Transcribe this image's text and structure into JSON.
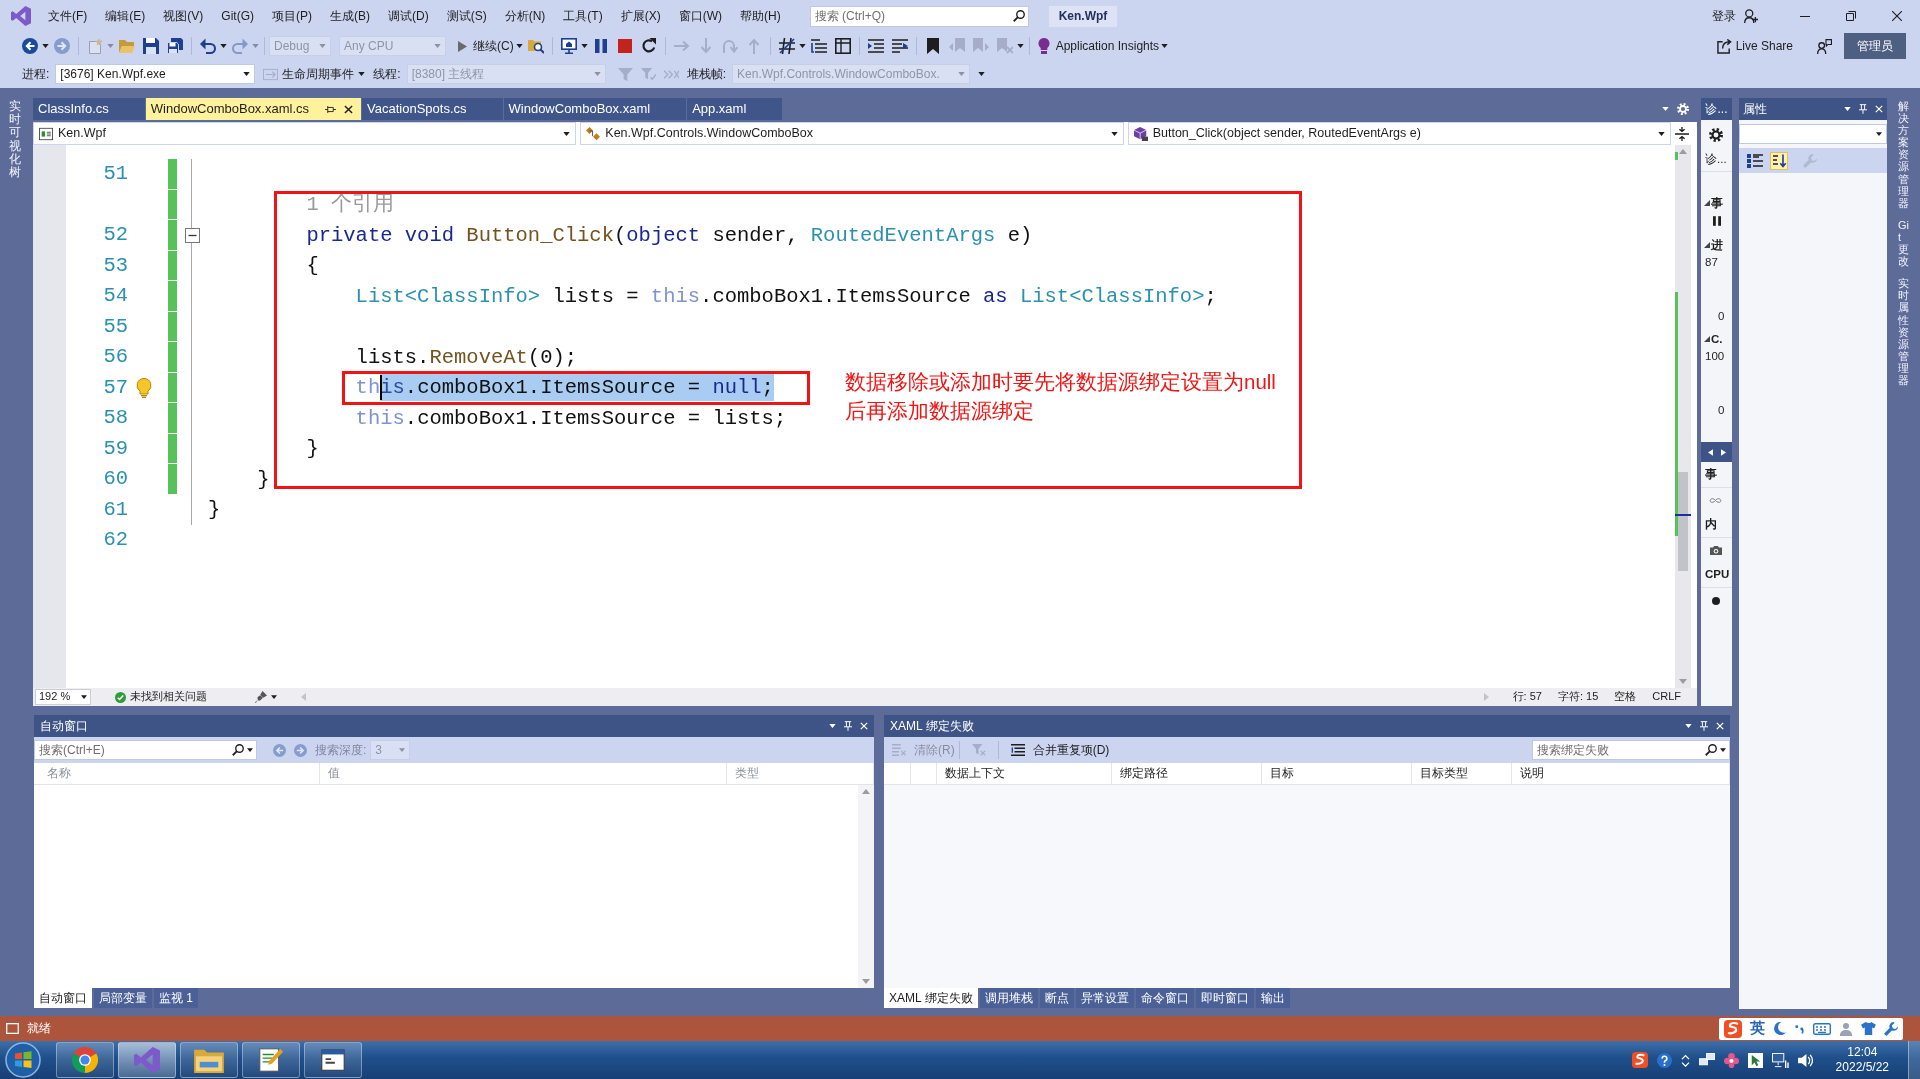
{
  "title_bar": {
    "menu": [
      "文件(F)",
      "编辑(E)",
      "视图(V)",
      "Git(G)",
      "项目(P)",
      "生成(B)",
      "调试(D)",
      "测试(S)",
      "分析(N)",
      "工具(T)",
      "扩展(X)",
      "窗口(W)",
      "帮助(H)"
    ],
    "search_placeholder": "搜索 (Ctrl+Q)",
    "solution": "Ken.Wpf",
    "sign_in": "登录"
  },
  "toolbar": {
    "groups": [
      [
        {
          "kind": "back",
          "disabled": false
        },
        {
          "kind": "caret",
          "disabled": false
        },
        {
          "kind": "forward",
          "disabled": true
        }
      ],
      [
        {
          "kind": "new",
          "disabled": true
        },
        {
          "kind": "caret",
          "disabled": true
        },
        {
          "kind": "open",
          "disabled": false
        },
        {
          "kind": "save",
          "disabled": false
        },
        {
          "kind": "saveall",
          "disabled": false
        }
      ],
      [
        {
          "kind": "undo",
          "disabled": false
        },
        {
          "kind": "caret",
          "disabled": false
        },
        {
          "kind": "redo",
          "disabled": true
        },
        {
          "kind": "caret",
          "disabled": true
        }
      ],
      [
        {
          "kind": "combo",
          "text": "Debug",
          "disabled": true
        },
        {
          "kind": "combo",
          "text": "Any CPU",
          "disabled": true
        },
        {
          "kind": "run",
          "text": "继续(C)",
          "disabled": false
        },
        {
          "kind": "caret",
          "disabled": false
        },
        {
          "kind": "find",
          "disabled": false
        }
      ],
      [
        {
          "kind": "monitor",
          "disabled": false
        },
        {
          "kind": "caret",
          "disabled": false
        },
        {
          "kind": "pause",
          "disabled": false
        },
        {
          "kind": "stop",
          "disabled": false
        },
        {
          "kind": "restart",
          "disabled": false
        }
      ],
      [
        {
          "kind": "arrow_right",
          "disabled": true
        },
        {
          "kind": "arrow_down",
          "disabled": true
        },
        {
          "kind": "arrow_curve",
          "disabled": true
        },
        {
          "kind": "arrow_up",
          "disabled": true
        }
      ],
      [
        {
          "kind": "hash",
          "disabled": false
        },
        {
          "kind": "caret",
          "disabled": false
        },
        {
          "kind": "list",
          "disabled": false
        },
        {
          "kind": "columns",
          "disabled": false
        }
      ],
      [
        {
          "kind": "indent",
          "disabled": false
        },
        {
          "kind": "comment",
          "disabled": false
        }
      ],
      [
        {
          "kind": "bookmark",
          "disabled": false
        },
        {
          "kind": "bookmark_prev",
          "disabled": true
        },
        {
          "kind": "bookmark_next",
          "disabled": true
        },
        {
          "kind": "bookmark_clear",
          "disabled": true
        },
        {
          "kind": "caret",
          "disabled": false
        }
      ],
      [
        {
          "kind": "insights",
          "text": "Application Insights",
          "disabled": false
        },
        {
          "kind": "caret",
          "disabled": false
        }
      ]
    ],
    "live_share": "Live Share",
    "admin": "管理员"
  },
  "debug_bar": {
    "process_label": "进程:",
    "process": "[3676] Ken.Wpf.exe",
    "lifecycle": "生命周期事件",
    "thread_label": "线程:",
    "thread": {
      "text": "[8380] 主线程",
      "disabled": true
    },
    "stack_label": "堆栈帧:",
    "stack_frame": {
      "text": "Ken.Wpf.Controls.WindowComboBox.",
      "disabled": true
    }
  },
  "left_strip": {
    "tabs": [
      "实时可视化树"
    ]
  },
  "editor": {
    "tabs": [
      {
        "label": "ClassInfo.cs",
        "selected": false
      },
      {
        "label": "WindowComboBox.xaml.cs",
        "selected": true
      },
      {
        "label": "VacationSpots.cs",
        "selected": false
      },
      {
        "label": "WindowComboBox.xaml",
        "selected": false
      },
      {
        "label": "App.xaml",
        "selected": false
      }
    ],
    "nav": {
      "project": "Ken.Wpf",
      "type": "Ken.Wpf.Controls.WindowComboBox",
      "member": "Button_Click(object sender, RoutedEventArgs e)"
    },
    "lines": [
      {
        "kind": "code",
        "number": "51",
        "changed": true
      },
      {
        "kind": "codelens",
        "text": "        1 个引用",
        "changed": true
      },
      {
        "kind": "code",
        "number": "52",
        "changed": true,
        "expanded": true,
        "segments": [
          {
            "selected": false,
            "tokens": [
              {
                "text": "        private void ",
                "kind": "keyword"
              },
              {
                "text": "Button_Click",
                "kind": "method"
              },
              {
                "text": "(",
                "kind": "plain"
              },
              {
                "text": "object",
                "kind": "keyword"
              },
              {
                "text": " sender, ",
                "kind": "plain"
              },
              {
                "text": "RoutedEventArgs",
                "kind": "type"
              },
              {
                "text": " e)",
                "kind": "plain"
              }
            ]
          }
        ]
      },
      {
        "kind": "code",
        "number": "53",
        "changed": true,
        "segments": [
          {
            "selected": false,
            "tokens": [
              {
                "text": "        {",
                "kind": "plain"
              }
            ]
          }
        ]
      },
      {
        "kind": "code",
        "number": "54",
        "changed": true,
        "segments": [
          {
            "selected": false,
            "tokens": [
              {
                "text": "            List<ClassInfo>",
                "kind": "type"
              },
              {
                "text": " lists = ",
                "kind": "plain"
              },
              {
                "text": "this",
                "kind": "this"
              },
              {
                "text": ".comboBox1.ItemsSource ",
                "kind": "plain"
              },
              {
                "text": "as ",
                "kind": "keyword"
              },
              {
                "text": "List<ClassInfo>",
                "kind": "type"
              },
              {
                "text": ";",
                "kind": "plain"
              }
            ]
          }
        ]
      },
      {
        "kind": "code",
        "number": "55",
        "changed": true
      },
      {
        "kind": "code",
        "number": "56",
        "changed": true,
        "segments": [
          {
            "selected": false,
            "tokens": [
              {
                "text": "            lists.",
                "kind": "plain"
              },
              {
                "text": "RemoveAt",
                "kind": "method"
              },
              {
                "text": "(0);",
                "kind": "plain"
              }
            ]
          }
        ]
      },
      {
        "kind": "code",
        "number": "57",
        "changed": true,
        "lightbulb": true,
        "segments": [
          {
            "selected": false,
            "tokens": [
              {
                "text": "            th",
                "kind": "this"
              }
            ]
          },
          {
            "selected": true,
            "caret": true,
            "tokens": [
              {
                "text": "is",
                "kind": "this"
              },
              {
                "text": ".comboBox1.ItemsSource = ",
                "kind": "plain"
              },
              {
                "text": "null",
                "kind": "keyword"
              },
              {
                "text": ";",
                "kind": "plain"
              }
            ]
          }
        ]
      },
      {
        "kind": "code",
        "number": "58",
        "changed": true,
        "segments": [
          {
            "selected": false,
            "tokens": [
              {
                "text": "            this",
                "kind": "this"
              },
              {
                "text": ".comboBox1.ItemsSource = lists;",
                "kind": "plain"
              }
            ]
          }
        ]
      },
      {
        "kind": "code",
        "number": "59",
        "changed": true,
        "segments": [
          {
            "selected": false,
            "tokens": [
              {
                "text": "        }",
                "kind": "plain"
              }
            ]
          }
        ]
      },
      {
        "kind": "code",
        "number": "60",
        "changed": true,
        "segments": [
          {
            "selected": false,
            "tokens": [
              {
                "text": "    }",
                "kind": "plain"
              }
            ]
          }
        ]
      },
      {
        "kind": "code",
        "number": "61",
        "changed": false,
        "segments": [
          {
            "selected": false,
            "tokens": [
              {
                "text": "}",
                "kind": "plain"
              }
            ]
          }
        ]
      },
      {
        "kind": "code",
        "number": "62",
        "changed": false
      }
    ],
    "annotation": {
      "note_lines": [
        "数据移除或添加时要先将数据源绑定设置为null",
        "后再添加数据源绑定"
      ]
    },
    "status": {
      "zoom": "192 %",
      "issues": "未找到相关问题",
      "line": "行: 57",
      "column": "字符: 15",
      "indent": "空格",
      "eol": "CRLF"
    }
  },
  "diagnostics": {
    "title": "诊...",
    "items": [
      {
        "kind": "gear"
      },
      {
        "kind": "label",
        "text": "诊..."
      },
      {
        "kind": "section",
        "text": "事"
      },
      {
        "kind": "pause"
      },
      {
        "kind": "section",
        "text": "进"
      },
      {
        "kind": "axis_max",
        "text": "87"
      },
      {
        "kind": "axis_min",
        "text": "0"
      },
      {
        "kind": "section",
        "text": "C."
      },
      {
        "kind": "axis_max",
        "text": "100"
      },
      {
        "kind": "axis_min",
        "text": "0"
      },
      {
        "kind": "nav"
      },
      {
        "kind": "heading",
        "text": "事"
      },
      {
        "kind": "infinity"
      },
      {
        "kind": "heading",
        "text": "内"
      },
      {
        "kind": "camera"
      },
      {
        "kind": "heading",
        "text": "CPU"
      },
      {
        "kind": "dot"
      }
    ]
  },
  "properties": {
    "title": "属性",
    "tools": [
      {
        "kind": "categorized",
        "selected": false
      },
      {
        "kind": "alphabetical",
        "selected": true
      }
    ],
    "wrench_disabled": true
  },
  "right_strip": {
    "tabs": [
      "解决方案资源管理器",
      "Git 更改",
      "实时属性资源管理器"
    ]
  },
  "autos": {
    "title": "自动窗口",
    "search_placeholder": "搜索(Ctrl+E)",
    "nav_disabled": true,
    "depth_label": "搜索深度:",
    "depth": {
      "text": "3",
      "disabled": true
    },
    "columns": [
      "名称",
      "值",
      "类型"
    ],
    "tabs": [
      {
        "label": "自动窗口",
        "selected": true
      },
      {
        "label": "局部变量",
        "selected": false
      },
      {
        "label": "监视 1",
        "selected": false
      }
    ]
  },
  "xaml_failures": {
    "title": "XAML 绑定失败",
    "clear": {
      "text": "清除(R)",
      "disabled": true
    },
    "filter_disabled": true,
    "merge": {
      "text": "合并重复项(D)",
      "disabled": false
    },
    "search_placeholder": "搜索绑定失败",
    "columns": [
      "数据上下文",
      "绑定路径",
      "目标",
      "目标类型",
      "说明"
    ],
    "tabs": [
      {
        "label": "XAML 绑定失败",
        "selected": true
      },
      {
        "label": "调用堆栈",
        "selected": false
      },
      {
        "label": "断点",
        "selected": false
      },
      {
        "label": "异常设置",
        "selected": false
      },
      {
        "label": "命令窗口",
        "selected": false
      },
      {
        "label": "即时窗口",
        "selected": false
      },
      {
        "label": "输出",
        "selected": false
      }
    ]
  },
  "status_bar": {
    "text": "就绪",
    "ime": "英"
  },
  "taskbar": {
    "apps": [
      {
        "kind": "browser",
        "selected": false
      },
      {
        "kind": "ide",
        "selected": true
      },
      {
        "kind": "folder",
        "selected": false
      },
      {
        "kind": "notepad",
        "selected": false
      },
      {
        "kind": "window",
        "selected": false
      }
    ],
    "time": "12:04",
    "date": "2022/5/22"
  }
}
